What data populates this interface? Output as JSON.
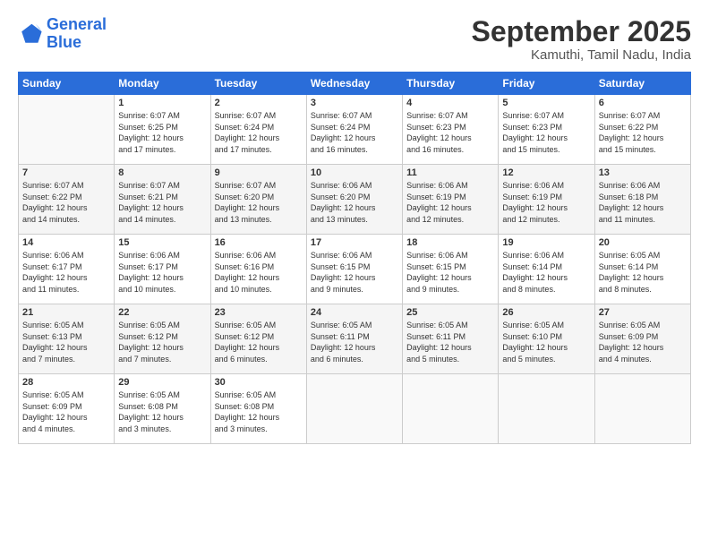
{
  "logo": {
    "line1": "General",
    "line2": "Blue"
  },
  "header": {
    "month": "September 2025",
    "location": "Kamuthi, Tamil Nadu, India"
  },
  "days_of_week": [
    "Sunday",
    "Monday",
    "Tuesday",
    "Wednesday",
    "Thursday",
    "Friday",
    "Saturday"
  ],
  "weeks": [
    [
      {
        "day": "",
        "info": ""
      },
      {
        "day": "1",
        "info": "Sunrise: 6:07 AM\nSunset: 6:25 PM\nDaylight: 12 hours\nand 17 minutes."
      },
      {
        "day": "2",
        "info": "Sunrise: 6:07 AM\nSunset: 6:24 PM\nDaylight: 12 hours\nand 17 minutes."
      },
      {
        "day": "3",
        "info": "Sunrise: 6:07 AM\nSunset: 6:24 PM\nDaylight: 12 hours\nand 16 minutes."
      },
      {
        "day": "4",
        "info": "Sunrise: 6:07 AM\nSunset: 6:23 PM\nDaylight: 12 hours\nand 16 minutes."
      },
      {
        "day": "5",
        "info": "Sunrise: 6:07 AM\nSunset: 6:23 PM\nDaylight: 12 hours\nand 15 minutes."
      },
      {
        "day": "6",
        "info": "Sunrise: 6:07 AM\nSunset: 6:22 PM\nDaylight: 12 hours\nand 15 minutes."
      }
    ],
    [
      {
        "day": "7",
        "info": "Sunrise: 6:07 AM\nSunset: 6:22 PM\nDaylight: 12 hours\nand 14 minutes."
      },
      {
        "day": "8",
        "info": "Sunrise: 6:07 AM\nSunset: 6:21 PM\nDaylight: 12 hours\nand 14 minutes."
      },
      {
        "day": "9",
        "info": "Sunrise: 6:07 AM\nSunset: 6:20 PM\nDaylight: 12 hours\nand 13 minutes."
      },
      {
        "day": "10",
        "info": "Sunrise: 6:06 AM\nSunset: 6:20 PM\nDaylight: 12 hours\nand 13 minutes."
      },
      {
        "day": "11",
        "info": "Sunrise: 6:06 AM\nSunset: 6:19 PM\nDaylight: 12 hours\nand 12 minutes."
      },
      {
        "day": "12",
        "info": "Sunrise: 6:06 AM\nSunset: 6:19 PM\nDaylight: 12 hours\nand 12 minutes."
      },
      {
        "day": "13",
        "info": "Sunrise: 6:06 AM\nSunset: 6:18 PM\nDaylight: 12 hours\nand 11 minutes."
      }
    ],
    [
      {
        "day": "14",
        "info": "Sunrise: 6:06 AM\nSunset: 6:17 PM\nDaylight: 12 hours\nand 11 minutes."
      },
      {
        "day": "15",
        "info": "Sunrise: 6:06 AM\nSunset: 6:17 PM\nDaylight: 12 hours\nand 10 minutes."
      },
      {
        "day": "16",
        "info": "Sunrise: 6:06 AM\nSunset: 6:16 PM\nDaylight: 12 hours\nand 10 minutes."
      },
      {
        "day": "17",
        "info": "Sunrise: 6:06 AM\nSunset: 6:15 PM\nDaylight: 12 hours\nand 9 minutes."
      },
      {
        "day": "18",
        "info": "Sunrise: 6:06 AM\nSunset: 6:15 PM\nDaylight: 12 hours\nand 9 minutes."
      },
      {
        "day": "19",
        "info": "Sunrise: 6:06 AM\nSunset: 6:14 PM\nDaylight: 12 hours\nand 8 minutes."
      },
      {
        "day": "20",
        "info": "Sunrise: 6:05 AM\nSunset: 6:14 PM\nDaylight: 12 hours\nand 8 minutes."
      }
    ],
    [
      {
        "day": "21",
        "info": "Sunrise: 6:05 AM\nSunset: 6:13 PM\nDaylight: 12 hours\nand 7 minutes."
      },
      {
        "day": "22",
        "info": "Sunrise: 6:05 AM\nSunset: 6:12 PM\nDaylight: 12 hours\nand 7 minutes."
      },
      {
        "day": "23",
        "info": "Sunrise: 6:05 AM\nSunset: 6:12 PM\nDaylight: 12 hours\nand 6 minutes."
      },
      {
        "day": "24",
        "info": "Sunrise: 6:05 AM\nSunset: 6:11 PM\nDaylight: 12 hours\nand 6 minutes."
      },
      {
        "day": "25",
        "info": "Sunrise: 6:05 AM\nSunset: 6:11 PM\nDaylight: 12 hours\nand 5 minutes."
      },
      {
        "day": "26",
        "info": "Sunrise: 6:05 AM\nSunset: 6:10 PM\nDaylight: 12 hours\nand 5 minutes."
      },
      {
        "day": "27",
        "info": "Sunrise: 6:05 AM\nSunset: 6:09 PM\nDaylight: 12 hours\nand 4 minutes."
      }
    ],
    [
      {
        "day": "28",
        "info": "Sunrise: 6:05 AM\nSunset: 6:09 PM\nDaylight: 12 hours\nand 4 minutes."
      },
      {
        "day": "29",
        "info": "Sunrise: 6:05 AM\nSunset: 6:08 PM\nDaylight: 12 hours\nand 3 minutes."
      },
      {
        "day": "30",
        "info": "Sunrise: 6:05 AM\nSunset: 6:08 PM\nDaylight: 12 hours\nand 3 minutes."
      },
      {
        "day": "",
        "info": ""
      },
      {
        "day": "",
        "info": ""
      },
      {
        "day": "",
        "info": ""
      },
      {
        "day": "",
        "info": ""
      }
    ]
  ]
}
